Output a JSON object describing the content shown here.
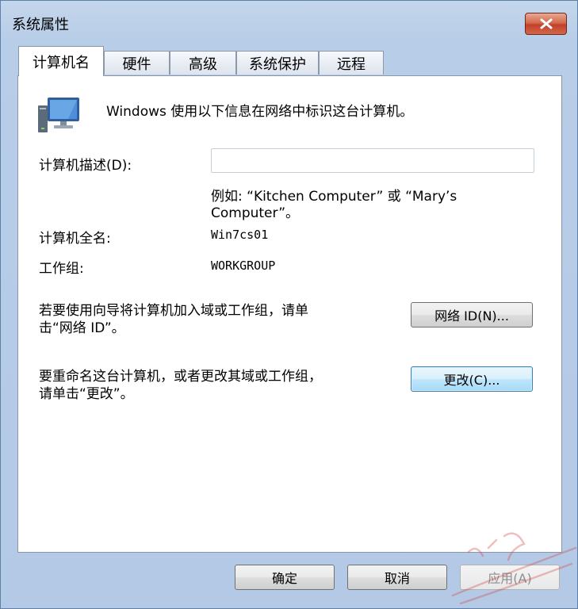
{
  "window": {
    "title": "系统属性"
  },
  "tabs": [
    {
      "label": "计算机名",
      "active": true
    },
    {
      "label": "硬件",
      "active": false
    },
    {
      "label": "高级",
      "active": false
    },
    {
      "label": "系统保护",
      "active": false
    },
    {
      "label": "远程",
      "active": false
    }
  ],
  "panel": {
    "intro_text": "Windows 使用以下信息在网络中标识这台计算机。",
    "description_label": "计算机描述(D):",
    "description_value": "",
    "example_line1": "例如: “Kitchen Computer” 或 “Mary’s",
    "example_line2": "Computer”。",
    "full_name_label": "计算机全名:",
    "full_name_value": "Win7cs01",
    "workgroup_label": "工作组:",
    "workgroup_value": "WORKGROUP",
    "network_id_text_line1": "若要使用向导将计算机加入域或工作组，请单",
    "network_id_text_line2": "击“网络 ID”。",
    "network_id_button": "网络 ID(N)...",
    "rename_text_line1": "要重命名这台计算机，或者更改其域或工作组，",
    "rename_text_line2": "请单击“更改”。",
    "change_button": "更改(C)..."
  },
  "footer": {
    "ok_button": "确定",
    "cancel_button": "取消",
    "apply_button": "应用(A)"
  },
  "colors": {
    "close_button": "#c2412a",
    "window_frame": "#b8cde8",
    "focus_button": "#bee6fd"
  }
}
